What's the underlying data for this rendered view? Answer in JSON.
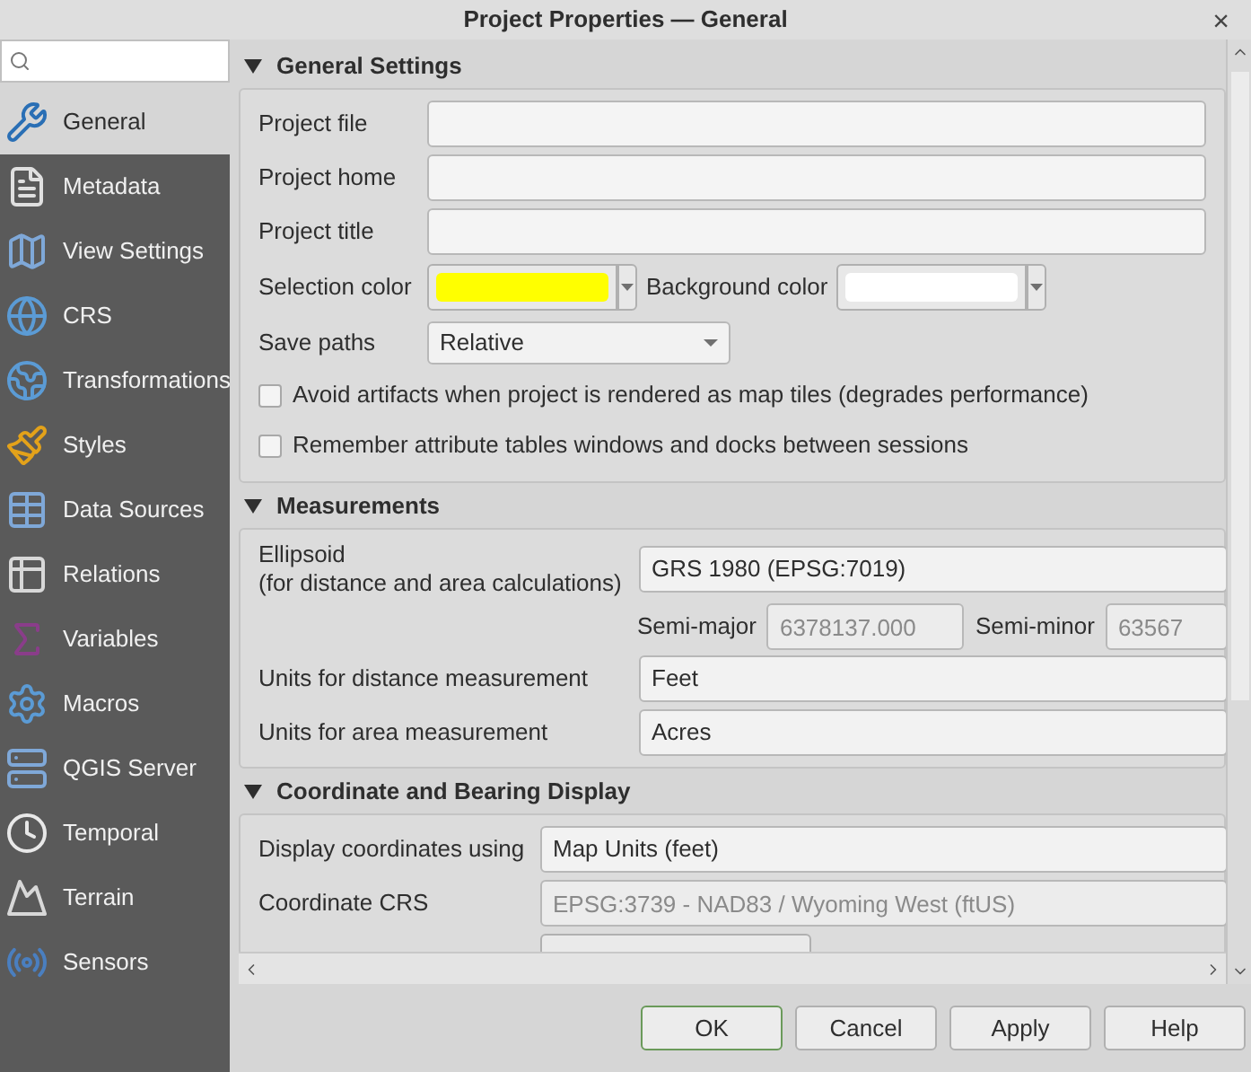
{
  "window": {
    "title": "Project Properties — General",
    "close": "×"
  },
  "sidebar": {
    "items": [
      {
        "label": "General",
        "selected": true
      },
      {
        "label": "Metadata",
        "selected": false
      },
      {
        "label": "View Settings",
        "selected": false
      },
      {
        "label": "CRS",
        "selected": false
      },
      {
        "label": "Transformations",
        "selected": false
      },
      {
        "label": "Styles",
        "selected": false
      },
      {
        "label": "Data Sources",
        "selected": false
      },
      {
        "label": "Relations",
        "selected": false
      },
      {
        "label": "Variables",
        "selected": false
      },
      {
        "label": "Macros",
        "selected": false
      },
      {
        "label": "QGIS Server",
        "selected": false
      },
      {
        "label": "Temporal",
        "selected": false
      },
      {
        "label": "Terrain",
        "selected": false
      },
      {
        "label": "Sensors",
        "selected": false
      }
    ]
  },
  "general_settings": {
    "title": "General Settings",
    "expanded": true,
    "project_file": {
      "label": "Project file"
    },
    "project_home": {
      "label": "Project home"
    },
    "project_title": {
      "label": "Project title"
    },
    "selection_color": {
      "label": "Selection color",
      "color": "#ffff00"
    },
    "background_color": {
      "label": "Background color",
      "color": "#ffffff"
    },
    "save_paths": {
      "label": "Save paths",
      "value": "Relative"
    },
    "checkboxes": [
      {
        "label": "Avoid artifacts when project is rendered as map tiles (degrades performance)",
        "checked": false
      },
      {
        "label": "Remember attribute tables windows and docks between sessions",
        "checked": false
      }
    ]
  },
  "measurements": {
    "title": "Measurements",
    "expanded": true,
    "ellipsoid": {
      "label": "Ellipsoid",
      "sublabel": "(for distance and area calculations)",
      "value": "GRS 1980 (EPSG:7019)"
    },
    "semi_major": {
      "label": "Semi-major",
      "value": "6378137.000",
      "disabled": true
    },
    "semi_minor": {
      "label": "Semi-minor",
      "value": "63567",
      "disabled": true
    },
    "distance_units": {
      "label": "Units for distance measurement",
      "value": "Feet"
    },
    "area_units": {
      "label": "Units for area measurement",
      "value": "Acres"
    }
  },
  "coordinate_display": {
    "title": "Coordinate and Bearing Display",
    "expanded": true,
    "display_using": {
      "label": "Display coordinates using",
      "value": "Map Units (feet)"
    },
    "coordinate_crs": {
      "label": "Coordinate CRS",
      "value": "EPSG:3739 - NAD83 / Wyoming West (ftUS)",
      "disabled": true
    }
  },
  "buttons": [
    {
      "label": "OK",
      "default": true
    },
    {
      "label": "Cancel",
      "default": false
    },
    {
      "label": "Apply",
      "default": false
    },
    {
      "label": "Help",
      "default": false
    }
  ]
}
